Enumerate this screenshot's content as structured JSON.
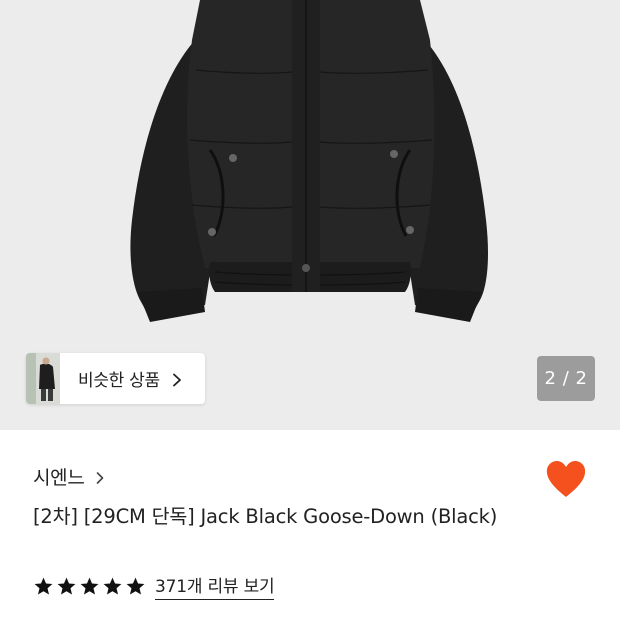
{
  "gallery": {
    "similar_label": "비슷한 상품",
    "counter": "2 / 2"
  },
  "product": {
    "brand": "시엔느",
    "title": "[2차] [29CM 단독] Jack Black Goose-Down (Black)",
    "rating_stars": 5,
    "review_link": "371개 리뷰 보기",
    "wishlisted": true
  },
  "colors": {
    "heart": "#f4511e",
    "star": "#111111",
    "counter_bg": "#9c9c9c",
    "gallery_bg": "#ececec"
  },
  "icons": [
    "chevron-right-icon",
    "heart-icon",
    "star-icon"
  ]
}
